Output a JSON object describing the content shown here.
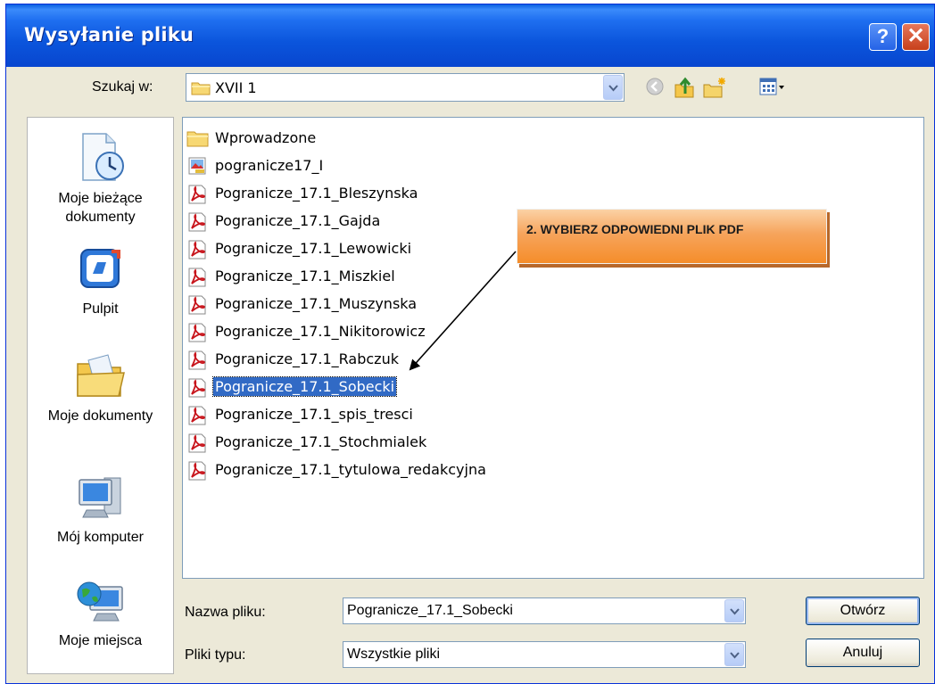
{
  "window": {
    "title": "Wysyłanie pliku",
    "help_label": "?",
    "close_label": "✕"
  },
  "lookin": {
    "label": "Szukaj w:",
    "value": "XVII 1"
  },
  "toolbar": {
    "icons": [
      "back-icon",
      "up-folder-icon",
      "new-folder-icon",
      "view-menu-icon"
    ]
  },
  "places": [
    {
      "label": "Moje bieżące\ndokumenty",
      "icon": "recent-documents-icon"
    },
    {
      "label": "Pulpit",
      "icon": "desktop-icon"
    },
    {
      "label": "Moje dokumenty",
      "icon": "my-documents-icon"
    },
    {
      "label": "Mój komputer",
      "icon": "my-computer-icon"
    },
    {
      "label": "Moje miejsca",
      "icon": "network-places-icon"
    }
  ],
  "files": [
    {
      "name": "Wprowadzone",
      "type": "folder"
    },
    {
      "name": "pogranicze17_I",
      "type": "image"
    },
    {
      "name": "Pogranicze_17.1_Bleszynska",
      "type": "pdf"
    },
    {
      "name": "Pogranicze_17.1_Gajda",
      "type": "pdf"
    },
    {
      "name": "Pogranicze_17.1_Lewowicki",
      "type": "pdf"
    },
    {
      "name": "Pogranicze_17.1_Miszkiel",
      "type": "pdf"
    },
    {
      "name": "Pogranicze_17.1_Muszynska",
      "type": "pdf"
    },
    {
      "name": "Pogranicze_17.1_Nikitorowicz",
      "type": "pdf"
    },
    {
      "name": "Pogranicze_17.1_Rabczuk",
      "type": "pdf"
    },
    {
      "name": "Pogranicze_17.1_Sobecki",
      "type": "pdf",
      "selected": true
    },
    {
      "name": "Pogranicze_17.1_spis_tresci",
      "type": "pdf"
    },
    {
      "name": "Pogranicze_17.1_Stochmialek",
      "type": "pdf"
    },
    {
      "name": "Pogranicze_17.1_tytulowa_redakcyjna",
      "type": "pdf"
    }
  ],
  "filename": {
    "label": "Nazwa pliku:",
    "value": "Pogranicze_17.1_Sobecki"
  },
  "filetype": {
    "label": "Pliki typu:",
    "value": "Wszystkie pliki"
  },
  "buttons": {
    "open": "Otwórz",
    "cancel": "Anuluj"
  },
  "annotation": {
    "text": "2. WYBIERZ ODPOWIEDNI PLIK PDF",
    "color": "#f7a25a"
  },
  "colors": {
    "titlebar": "#0b55dc",
    "dialog_bg": "#ece9d8",
    "selection": "#316ac5"
  }
}
